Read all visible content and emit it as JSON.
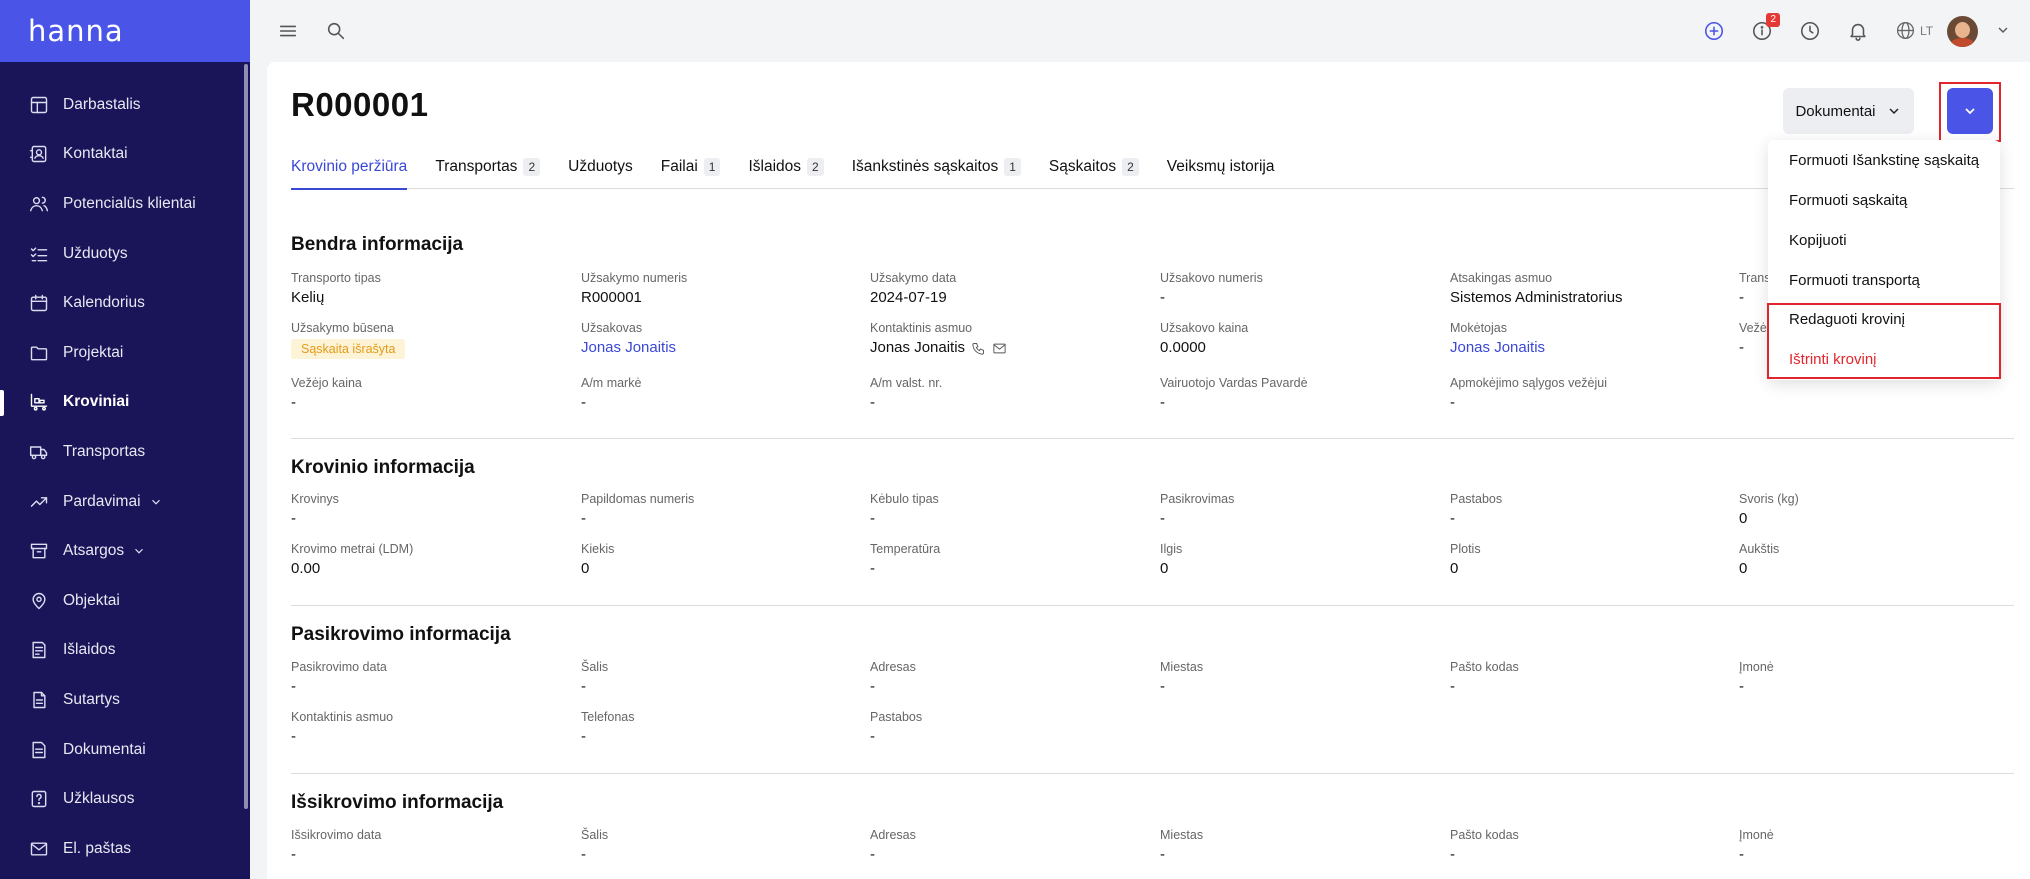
{
  "app": {
    "logo": "hanna"
  },
  "sidebar": {
    "items": [
      {
        "label": "Darbastalis",
        "icon": "dashboard-icon"
      },
      {
        "label": "Kontaktai",
        "icon": "contacts-icon"
      },
      {
        "label": "Potencialūs klientai",
        "icon": "leads-icon"
      },
      {
        "label": "Užduotys",
        "icon": "tasks-icon"
      },
      {
        "label": "Kalendorius",
        "icon": "calendar-icon"
      },
      {
        "label": "Projektai",
        "icon": "folder-icon"
      },
      {
        "label": "Kroviniai",
        "icon": "cargo-icon",
        "active": true
      },
      {
        "label": "Transportas",
        "icon": "truck-icon"
      },
      {
        "label": "Pardavimai",
        "icon": "sales-icon",
        "expandable": true
      },
      {
        "label": "Atsargos",
        "icon": "archive-icon",
        "expandable": true
      },
      {
        "label": "Objektai",
        "icon": "location-icon"
      },
      {
        "label": "Išlaidos",
        "icon": "expenses-icon"
      },
      {
        "label": "Sutartys",
        "icon": "contract-icon"
      },
      {
        "label": "Dokumentai",
        "icon": "documents-icon"
      },
      {
        "label": "Užklausos",
        "icon": "inquiry-icon"
      },
      {
        "label": "El. paštas",
        "icon": "mail-icon"
      }
    ]
  },
  "topbar": {
    "notification_count": "2",
    "language": "LT"
  },
  "page": {
    "title": "R000001",
    "documents_button": "Dokumentai"
  },
  "tabs": [
    {
      "label": "Krovinio peržiūra",
      "active": true
    },
    {
      "label": "Transportas",
      "count": "2"
    },
    {
      "label": "Užduotys"
    },
    {
      "label": "Failai",
      "count": "1"
    },
    {
      "label": "Išlaidos",
      "count": "2"
    },
    {
      "label": "Išankstinės sąskaitos",
      "count": "1"
    },
    {
      "label": "Sąskaitos",
      "count": "2"
    },
    {
      "label": "Veiksmų istorija"
    }
  ],
  "general": {
    "title": "Bendra informacija",
    "transport_type": {
      "label": "Transporto tipas",
      "value": "Kelių"
    },
    "order_number": {
      "label": "Užsakymo numeris",
      "value": "R000001"
    },
    "order_date": {
      "label": "Užsakymo data",
      "value": "2024-07-19"
    },
    "customer_number": {
      "label": "Užsakovo numeris",
      "value": "-"
    },
    "responsible": {
      "label": "Atsakingas asmuo",
      "value": "Sistemos Administratorius"
    },
    "trans_partial": {
      "label": "Trans",
      "value": "-"
    },
    "order_status": {
      "label": "Užsakymo būsena",
      "value": "Sąskaita išrašyta"
    },
    "customer": {
      "label": "Užsakovas",
      "value": "Jonas Jonaitis"
    },
    "contact_person": {
      "label": "Kontaktinis asmuo",
      "value": "Jonas Jonaitis"
    },
    "customer_price": {
      "label": "Užsakovo kaina",
      "value": "0.0000"
    },
    "payer": {
      "label": "Mokėtojas",
      "value": "Jonas Jonaitis"
    },
    "carrier_partial": {
      "label": "Vežė",
      "value": "-"
    },
    "carrier_price": {
      "label": "Vežėjo kaina",
      "value": "-"
    },
    "car_brand": {
      "label": "A/m markė",
      "value": "-"
    },
    "car_plate": {
      "label": "A/m valst. nr.",
      "value": "-"
    },
    "driver": {
      "label": "Vairuotojo Vardas Pavardė",
      "value": "-"
    },
    "payment_terms": {
      "label": "Apmokėjimo sąlygos vežėjui",
      "value": "-"
    }
  },
  "cargo": {
    "title": "Krovinio informacija",
    "cargo": {
      "label": "Krovinys",
      "value": "-"
    },
    "extra_number": {
      "label": "Papildomas numeris",
      "value": "-"
    },
    "body_type": {
      "label": "Kėbulo tipas",
      "value": "-"
    },
    "loading": {
      "label": "Pasikrovimas",
      "value": "-"
    },
    "notes": {
      "label": "Pastabos",
      "value": "-"
    },
    "weight": {
      "label": "Svoris (kg)",
      "value": "0"
    },
    "ldm": {
      "label": "Krovimo metrai (LDM)",
      "value": "0.00"
    },
    "quantity": {
      "label": "Kiekis",
      "value": "0"
    },
    "temperature": {
      "label": "Temperatūra",
      "value": "-"
    },
    "length": {
      "label": "Ilgis",
      "value": "0"
    },
    "width": {
      "label": "Plotis",
      "value": "0"
    },
    "height": {
      "label": "Aukštis",
      "value": "0"
    }
  },
  "loading": {
    "title": "Pasikrovimo informacija",
    "date": {
      "label": "Pasikrovimo data",
      "value": "-"
    },
    "country": {
      "label": "Šalis",
      "value": "-"
    },
    "address": {
      "label": "Adresas",
      "value": "-"
    },
    "city": {
      "label": "Miestas",
      "value": "-"
    },
    "postcode": {
      "label": "Pašto kodas",
      "value": "-"
    },
    "company": {
      "label": "Įmonė",
      "value": "-"
    },
    "contact": {
      "label": "Kontaktinis asmuo",
      "value": "-"
    },
    "phone": {
      "label": "Telefonas",
      "value": "-"
    },
    "notes": {
      "label": "Pastabos",
      "value": "-"
    }
  },
  "unloading": {
    "title": "Išsikrovimo informacija",
    "date": {
      "label": "Išsikrovimo data",
      "value": "-"
    },
    "country": {
      "label": "Šalis",
      "value": "-"
    },
    "address": {
      "label": "Adresas",
      "value": "-"
    },
    "city": {
      "label": "Miestas",
      "value": "-"
    },
    "postcode": {
      "label": "Pašto kodas",
      "value": "-"
    },
    "company": {
      "label": "Įmonė",
      "value": "-"
    }
  },
  "dropdown": {
    "items": [
      {
        "label": "Formuoti Išankstinę sąskaitą"
      },
      {
        "label": "Formuoti sąskaitą"
      },
      {
        "label": "Kopijuoti"
      },
      {
        "label": "Formuoti transportą"
      },
      {
        "label": "Redaguoti krovinį"
      },
      {
        "label": "Ištrinti krovinį",
        "danger": true
      }
    ]
  },
  "colors": {
    "sidebar": "#1a1458",
    "accent": "#4a55e8",
    "danger": "#e0262c",
    "link": "#3a48d6"
  }
}
